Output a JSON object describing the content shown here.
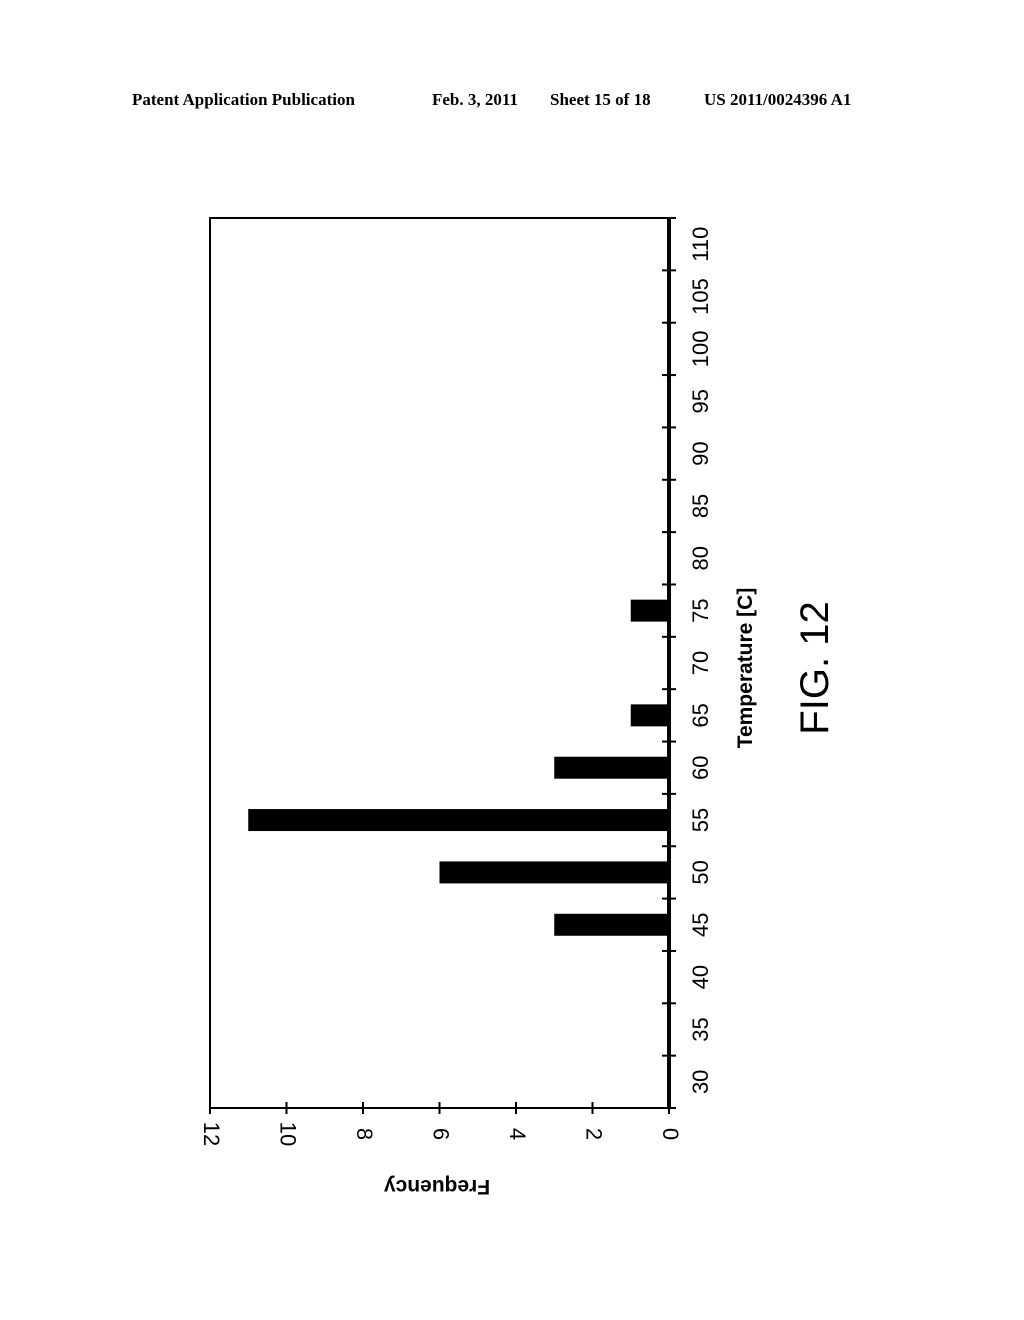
{
  "header": {
    "publication": "Patent Application Publication",
    "date": "Feb. 3, 2011",
    "sheet": "Sheet 15 of 18",
    "number": "US 2011/0024396 A1"
  },
  "figure_label": "FIG. 12",
  "chart_data": {
    "type": "bar",
    "orientation": "rotated 90 degrees clockwise on page",
    "title": "",
    "xlabel": "Temperature [C]",
    "ylabel": "Frequency",
    "categories": [
      "30",
      "35",
      "40",
      "45",
      "50",
      "55",
      "60",
      "65",
      "70",
      "75",
      "80",
      "85",
      "90",
      "95",
      "100",
      "105",
      "110"
    ],
    "values": [
      0,
      0,
      0,
      3,
      6,
      11,
      3,
      1,
      0,
      1,
      0,
      0,
      0,
      0,
      0,
      0,
      0
    ],
    "ylim": [
      0,
      12
    ],
    "yticks": [
      "0",
      "2",
      "4",
      "6",
      "8",
      "10",
      "12"
    ],
    "grid": false,
    "legend": "none",
    "bar_color": "#000000"
  }
}
